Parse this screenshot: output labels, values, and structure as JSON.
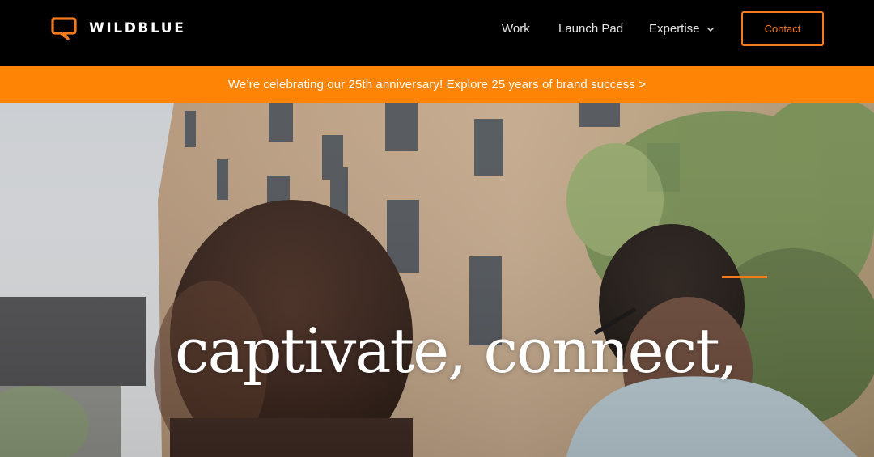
{
  "brand": {
    "name": "WILDBLUE",
    "accent_color": "#f47a20",
    "logo_icon": "speech-bubble-q-icon"
  },
  "nav": {
    "items": [
      {
        "label": "Work"
      },
      {
        "label": "Launch Pad"
      },
      {
        "label": "Expertise",
        "icon": "chevron-down-icon"
      }
    ],
    "contact_label": "Contact"
  },
  "banner": {
    "text": "We’re celebrating our 25th anniversary! Explore 25 years of brand success >",
    "background_color": "#fd8405"
  },
  "hero": {
    "headline": "captivate, connect,"
  }
}
